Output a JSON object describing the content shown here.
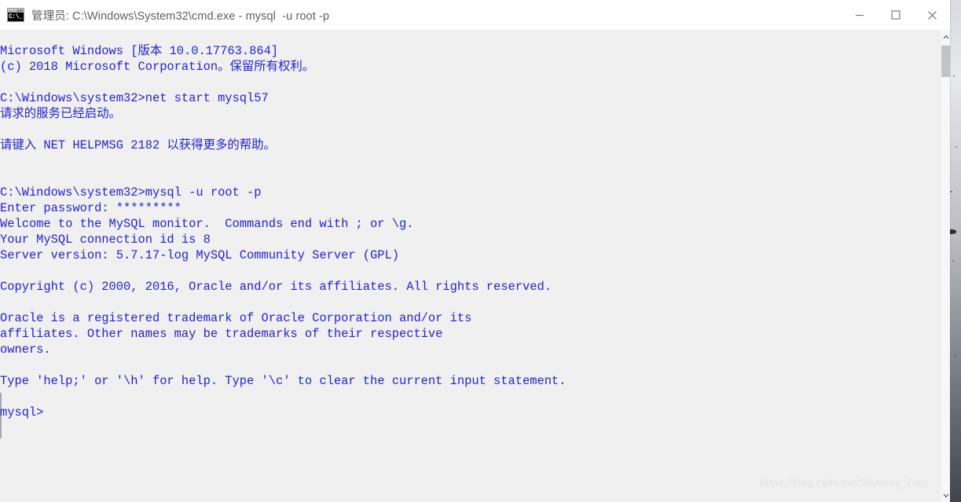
{
  "window": {
    "title": "管理员: C:\\Windows\\System32\\cmd.exe - mysql  -u root -p",
    "app_icon_glyph": "C:\\_",
    "controls": {
      "minimize_label": "Minimize",
      "maximize_label": "Maximize",
      "close_label": "Close"
    }
  },
  "console": {
    "background_color": "#f0f0f0",
    "text_color": "#2222d6",
    "lines": [
      "Microsoft Windows [版本 10.0.17763.864]",
      "(c) 2018 Microsoft Corporation。保留所有权利。",
      "",
      "C:\\Windows\\system32>net start mysql57",
      "请求的服务已经启动。",
      "",
      "请键入 NET HELPMSG 2182 以获得更多的帮助。",
      "",
      "",
      "C:\\Windows\\system32>mysql -u root -p",
      "Enter password: *********",
      "Welcome to the MySQL monitor.  Commands end with ; or \\g.",
      "Your MySQL connection id is 8",
      "Server version: 5.7.17-log MySQL Community Server (GPL)",
      "",
      "Copyright (c) 2000, 2016, Oracle and/or its affiliates. All rights reserved.",
      "",
      "Oracle is a registered trademark of Oracle Corporation and/or its",
      "affiliates. Other names may be trademarks of their respective",
      "owners.",
      "",
      "Type 'help;' or '\\h' for help. Type '\\c' to clear the current input statement.",
      "",
      "mysql>"
    ]
  },
  "watermark": {
    "text": "https://blog.csdn.net/Siamese_Cats"
  },
  "scrollbar": {
    "up_arrow": "▲",
    "down_arrow": "▼"
  }
}
